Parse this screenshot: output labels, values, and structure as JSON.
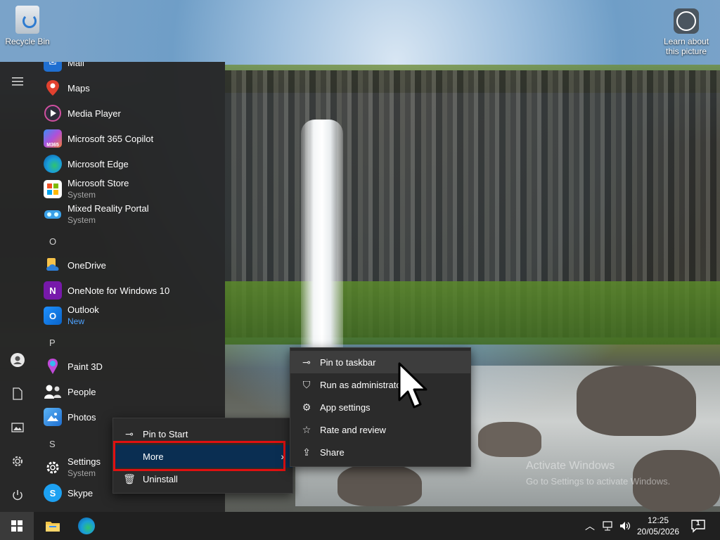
{
  "desktop": {
    "recycle_bin": "Recycle Bin",
    "learn_line1": "Learn about",
    "learn_line2": "this picture",
    "watermark_line1": "Activate Windows",
    "watermark_line2": "Go to Settings to activate Windows."
  },
  "start_menu": {
    "rail": [
      "hamburger-icon",
      "user-icon",
      "document-icon",
      "pictures-icon",
      "settings-icon",
      "power-icon"
    ],
    "apps": {
      "mail": "Mail",
      "maps": "Maps",
      "media_player": "Media Player",
      "m365": "Microsoft 365 Copilot",
      "m365_badge": "M365",
      "edge": "Microsoft Edge",
      "store": "Microsoft Store",
      "store_sub": "System",
      "mixed": "Mixed Reality Portal",
      "mixed_sub": "System",
      "letter_o": "O",
      "onedrive": "OneDrive",
      "onenote": "OneNote for Windows 10",
      "outlook": "Outlook",
      "outlook_sub": "New",
      "letter_p": "P",
      "paint3d": "Paint 3D",
      "people": "People",
      "photos": "Photos",
      "letter_s": "S",
      "settings": "Settings",
      "settings_sub": "System",
      "skype": "Skype"
    }
  },
  "context_menu": {
    "pin_start": "Pin to Start",
    "more": "More",
    "uninstall": "Uninstall"
  },
  "more_submenu": {
    "pin_taskbar": "Pin to taskbar",
    "run_admin": "Run as administrator",
    "app_settings": "App settings",
    "rate_review": "Rate and review",
    "share": "Share"
  },
  "taskbar": {
    "time": "12:25",
    "date": "20/05/2026",
    "notification_count": "1"
  },
  "colors": {
    "highlight": "#0a2e52",
    "annotation": "#e01010",
    "accent_blue": "#4da3ff"
  }
}
